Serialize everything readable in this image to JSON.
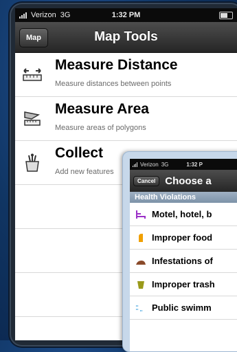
{
  "status": {
    "carrier": "Verizon",
    "network": "3G",
    "time": "1:32 PM"
  },
  "navbar": {
    "back_label": "Map",
    "title": "Map Tools"
  },
  "tools": [
    {
      "title": "Measure Distance",
      "subtitle": "Measure distances between points",
      "icon": "ruler-icon"
    },
    {
      "title": "Measure Area",
      "subtitle": "Measure areas of polygons",
      "icon": "area-icon"
    },
    {
      "title": "Collect",
      "subtitle": "Add new features",
      "icon": "collect-icon"
    }
  ],
  "overlay": {
    "status": {
      "carrier": "Verizon",
      "network": "3G",
      "time": "1:32 P"
    },
    "cancel_label": "Cancel",
    "title": "Choose a",
    "section": "Health Violations",
    "items": [
      {
        "label": "Motel, hotel, b",
        "icon": "motel-icon",
        "color": "#9b30c8"
      },
      {
        "label": "Improper food",
        "icon": "food-icon",
        "color": "#f0a000"
      },
      {
        "label": "Infestations of",
        "icon": "pest-icon",
        "color": "#8a4a2a"
      },
      {
        "label": "Improper trash",
        "icon": "trash-icon",
        "color": "#9a9a1a"
      },
      {
        "label": "Public swimm",
        "icon": "swimming-icon",
        "color": "#4aa8e0"
      }
    ]
  }
}
